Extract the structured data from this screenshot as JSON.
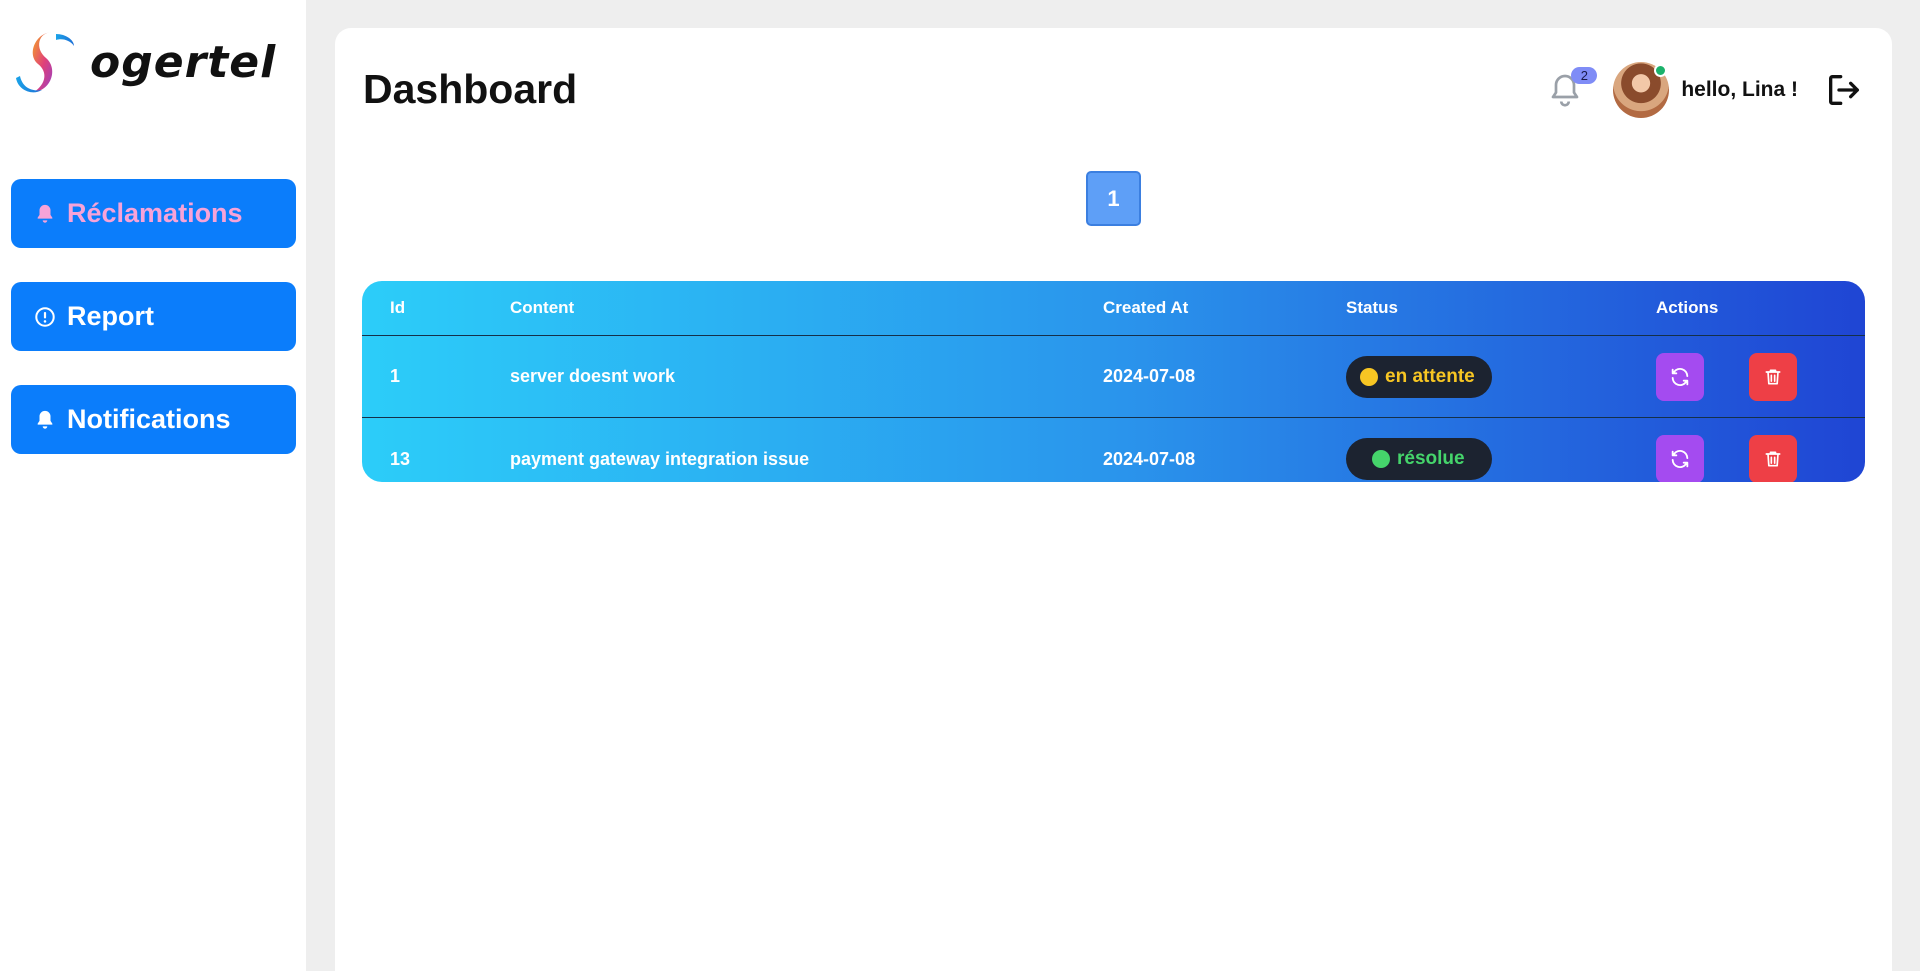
{
  "brand": {
    "name": "ogertel"
  },
  "sidebar": {
    "items": [
      {
        "label": "Réclamations",
        "icon": "bell-icon",
        "active": true
      },
      {
        "label": "Report",
        "icon": "alert-circle-icon",
        "active": false
      },
      {
        "label": "Notifications",
        "icon": "bell-icon",
        "active": false
      }
    ]
  },
  "header": {
    "title": "Dashboard",
    "notification_count": "2",
    "greeting": "hello, Lina !"
  },
  "pagination": {
    "current_page": "1"
  },
  "table": {
    "columns": [
      "Id",
      "Content",
      "Created At",
      "Status",
      "Actions"
    ],
    "rows": [
      {
        "id": "1",
        "content": "server doesnt work",
        "created_at": "2024-07-08",
        "status": "en attente"
      },
      {
        "id": "13",
        "content": "payment gateway integration issue",
        "created_at": "2024-07-08",
        "status": "résolue"
      }
    ]
  },
  "colors": {
    "nav_bg": "#0b7dfb",
    "nav_active_text": "#f7a3d8",
    "status_pending": "#f7c623",
    "status_resolved": "#45d46b",
    "refresh_button": "#a44bf0",
    "delete_button": "#ee3f46"
  }
}
